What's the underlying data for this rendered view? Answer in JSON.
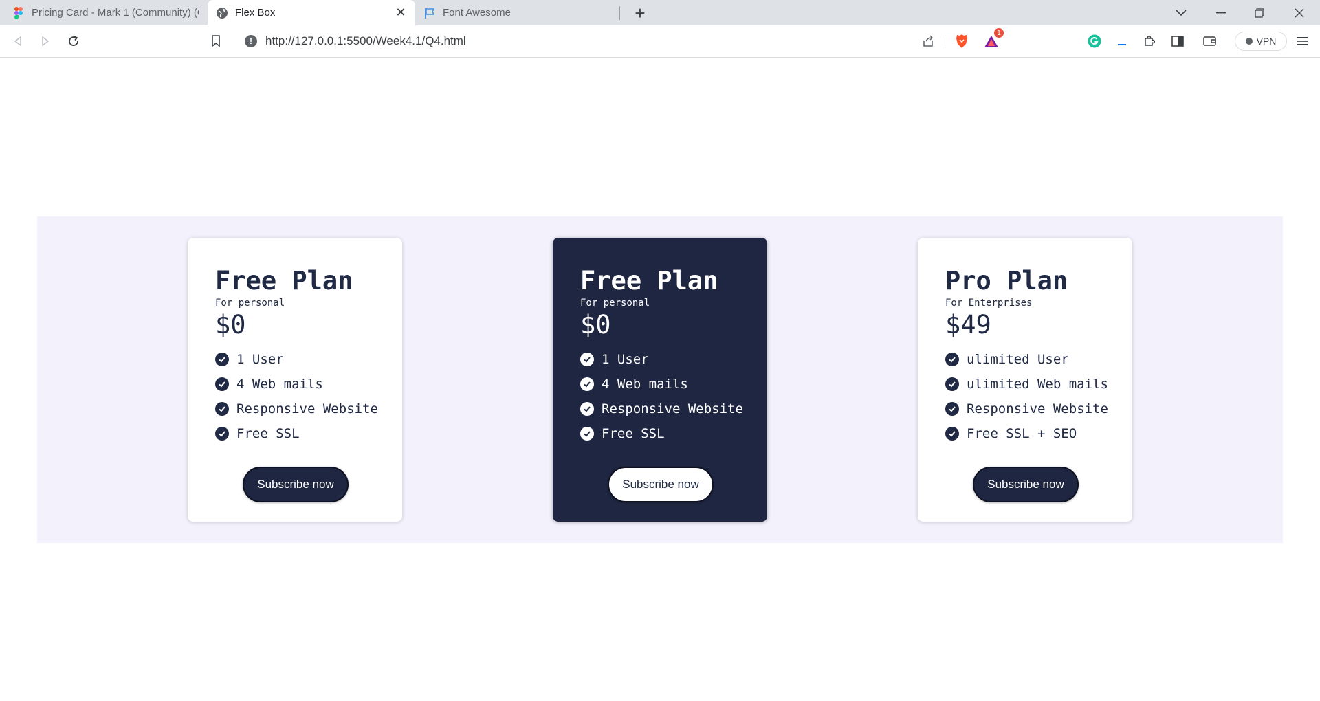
{
  "browser": {
    "tabs": [
      {
        "title": "Pricing Card - Mark 1 (Community) (Co",
        "icon": "figma-icon",
        "active": false
      },
      {
        "title": "Flex Box",
        "icon": "globe-icon",
        "active": true
      },
      {
        "title": "Font Awesome",
        "icon": "flag-icon",
        "active": false
      }
    ],
    "url": "http://127.0.0.1:5500/Week4.1/Q4.html",
    "vpn_label": "VPN",
    "notification_count": "1"
  },
  "cards": [
    {
      "title": "Free Plan",
      "subtitle": "For personal",
      "price": "$0",
      "features": [
        "1 User",
        "4 Web mails",
        "Responsive Website",
        "Free SSL"
      ],
      "button": "Subscribe now",
      "theme": "light"
    },
    {
      "title": "Free Plan",
      "subtitle": "For personal",
      "price": "$0",
      "features": [
        "1 User",
        "4 Web mails",
        "Responsive Website",
        "Free SSL"
      ],
      "button": "Subscribe now",
      "theme": "dark"
    },
    {
      "title": "Pro Plan",
      "subtitle": "For Enterprises",
      "price": "$49",
      "features": [
        "ulimited User",
        "ulimited Web mails",
        "Responsive Website",
        "Free SSL + SEO"
      ],
      "button": "Subscribe now",
      "theme": "light"
    }
  ],
  "colors": {
    "section_bg": "#f2f1fc",
    "card_dark": "#1f2641",
    "text_dark": "#202a44"
  }
}
